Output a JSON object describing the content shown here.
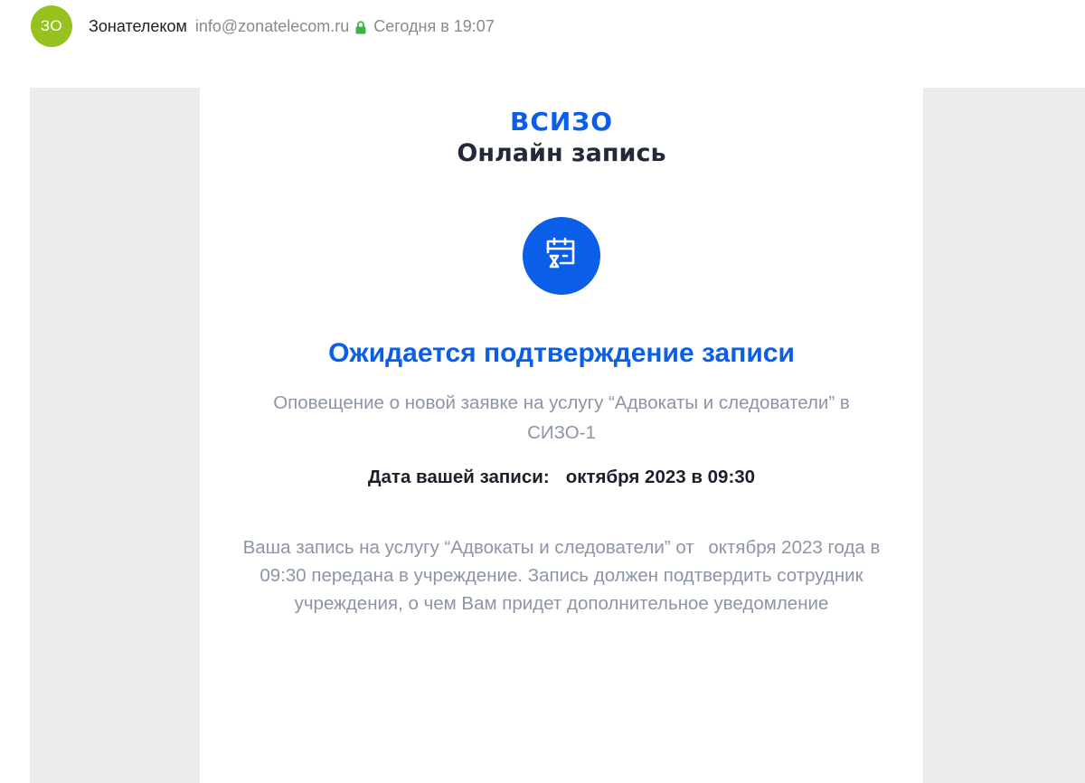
{
  "message_header": {
    "avatar_initials": "ЗО",
    "sender_name": "Зонателеком",
    "sender_email": "info@zonatelecom.ru",
    "security_icon": "lock-icon",
    "received_time": "Сегодня в 19:07",
    "avatar_color": "#96c11f",
    "lock_color": "#3cb34a"
  },
  "email": {
    "brand": "ВСИЗО",
    "brand_subtitle": "Онлайн запись",
    "status_icon": "calendar-hourglass-icon",
    "title": "Ожидается подтверждение записи",
    "notice": "Оповещение о новой заявке на услугу “Адвокаты и следователи” в СИЗО-1",
    "date_label": "Дата вашей записи:",
    "date_value": "октября 2023 в 09:30",
    "body_part1": "Ваша запись на услугу “Адвокаты и следователи” от",
    "body_part2": "октября 2023 года в 09:30 передана в учреждение. Запись должен подтвердить сотрудник учреждения, о чем Вам придет дополнительное уведомление",
    "accent_color": "#0a5ee8",
    "muted_text_color": "#8c95a8"
  }
}
